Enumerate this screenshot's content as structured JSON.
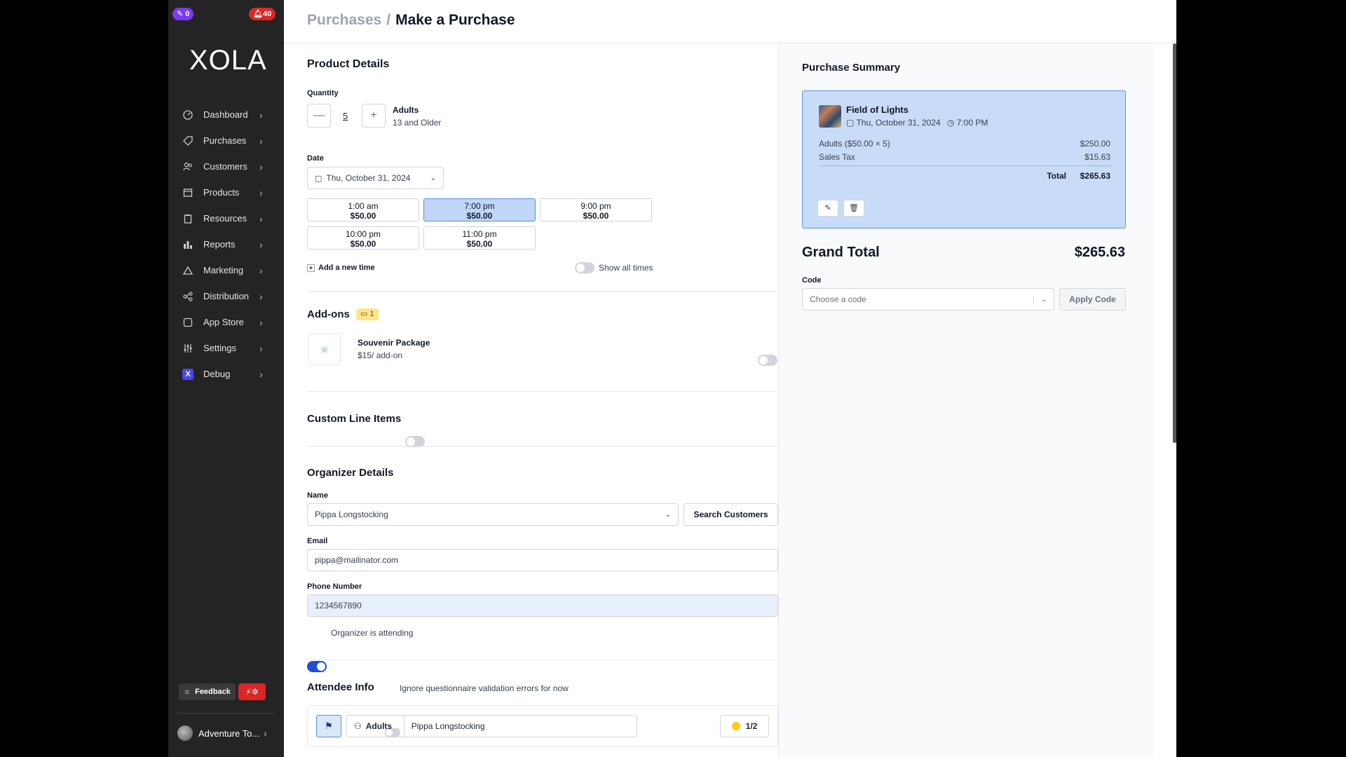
{
  "sidebar": {
    "badges": {
      "purple": "0",
      "red": "40"
    },
    "logo": "XOLA",
    "items": [
      {
        "label": "Dashboard",
        "icon": "dashboard-icon"
      },
      {
        "label": "Purchases",
        "icon": "tag-icon"
      },
      {
        "label": "Customers",
        "icon": "users-icon"
      },
      {
        "label": "Products",
        "icon": "box-icon"
      },
      {
        "label": "Resources",
        "icon": "clipboard-icon"
      },
      {
        "label": "Reports",
        "icon": "bar-chart-icon"
      },
      {
        "label": "Marketing",
        "icon": "megaphone-icon"
      },
      {
        "label": "Distribution",
        "icon": "network-icon"
      },
      {
        "label": "App Store",
        "icon": "square-icon"
      },
      {
        "label": "Settings",
        "icon": "sliders-icon"
      },
      {
        "label": "Debug",
        "icon": "x-icon"
      }
    ],
    "feedback_label": "Feedback",
    "account_label": "Adventure To..."
  },
  "header": {
    "crumb_parent": "Purchases",
    "separator": "/",
    "crumb_current": "Make a Purchase"
  },
  "product": {
    "title": "Product Details",
    "quantity_label": "Quantity",
    "quantity_value": "5",
    "demographic_name": "Adults",
    "demographic_desc": "13 and Older",
    "date_label": "Date",
    "date_value": "Thu, October 31, 2024",
    "slots": [
      {
        "time": "1:00 am",
        "price": "$50.00",
        "selected": false
      },
      {
        "time": "7:00 pm",
        "price": "$50.00",
        "selected": true
      },
      {
        "time": "9:00 pm",
        "price": "$50.00",
        "selected": false
      },
      {
        "time": "10:00 pm",
        "price": "$50.00",
        "selected": false
      },
      {
        "time": "11:00 pm",
        "price": "$50.00",
        "selected": false
      }
    ],
    "add_time_label": "Add a new time",
    "show_all_label": "Show all times"
  },
  "addons": {
    "title": "Add-ons",
    "count": "1",
    "item_name": "Souvenir Package",
    "item_price": "$15/ add-on"
  },
  "custom_line_items": {
    "title": "Custom Line Items"
  },
  "organizer": {
    "title": "Organizer Details",
    "name_label": "Name",
    "name_value": "Pippa Longstocking",
    "search_customers": "Search Customers",
    "email_label": "Email",
    "email_value": "pippa@mailinator.com",
    "phone_label": "Phone Number",
    "phone_value": "1234567890",
    "attending_label": "Organizer is attending"
  },
  "attendee": {
    "title": "Attendee Info",
    "ignore_label": "Ignore questionnaire validation errors for now",
    "demographic": "Adults",
    "name": "Pippa Longstocking",
    "progress": "1/2"
  },
  "summary": {
    "title": "Purchase Summary",
    "product_name": "Field of Lights",
    "date": "Thu, October 31, 2024",
    "time": "7:00 PM",
    "line1_label": "Adults ($50.00 × 5)",
    "line1_value": "$250.00",
    "tax_label": "Sales Tax",
    "tax_value": "$15.63",
    "total_label": "Total",
    "total_value": "$265.63",
    "grand_total_label": "Grand Total",
    "grand_total_value": "$265.63",
    "code_label": "Code",
    "code_placeholder": "Choose a code",
    "apply_code": "Apply Code"
  },
  "colors": {
    "accent": "#1d4ed8",
    "selected_slot": "#bfd6f6",
    "card": "#c9dcf7",
    "sidebar": "#242424"
  }
}
